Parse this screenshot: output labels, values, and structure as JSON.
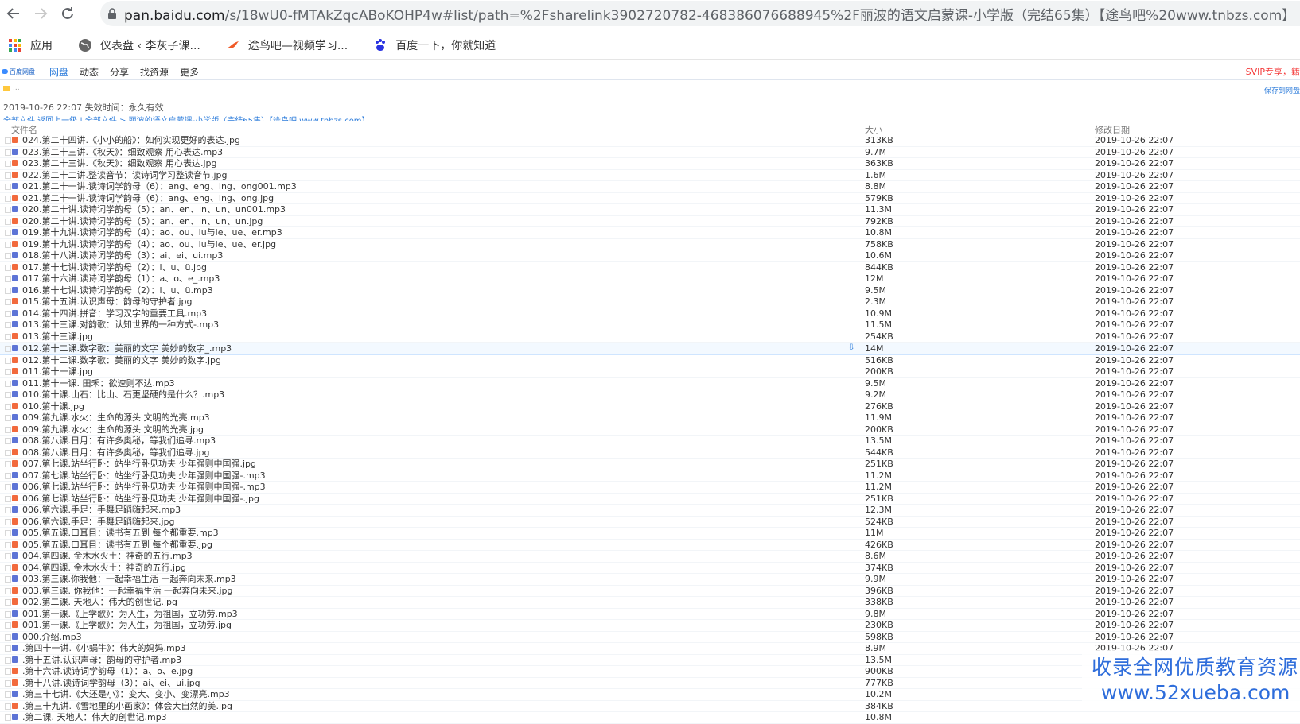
{
  "browser": {
    "url_domain": "pan.baidu.com",
    "url_path": "/s/18wU0-fMTAkZqcABoKOHP4w#list/path=%2Fsharelink3902720782-468386076688945%2F丽波的语文启蒙课-小学版（完结65集）【途鸟吧%20www.tnbzs.com】",
    "back_icon": "arrow-left-icon",
    "forward_icon": "arrow-right-icon",
    "reload_icon": "reload-icon"
  },
  "bookmarks": [
    {
      "label": "应用",
      "icon": "apps-grid-icon"
    },
    {
      "label": "仪表盘 ‹ 李灰子课...",
      "icon": "globe-icon"
    },
    {
      "label": "途鸟吧—视频学习...",
      "icon": "bird-icon"
    },
    {
      "label": "百度一下，你就知道",
      "icon": "paw-icon"
    }
  ],
  "pan": {
    "logo_text": "百度网盘",
    "nav": [
      "网盘",
      "动态",
      "分享",
      "找资源",
      "更多"
    ],
    "svip": "SVIP专享，籍",
    "folder_label": "...",
    "save_label": "保存到网盘",
    "share_time": "2019-10-26 22:07",
    "expire_label": "失效时间：永久有效",
    "breadcrumb": "全部文件  返回上一级 | 全部文件 > 丽波的语文启蒙课-小学版（完结65集）【途鸟吧 www.tnbzs.com】",
    "col_name": "文件名",
    "col_size": "大小",
    "col_date": "修改日期"
  },
  "files": [
    {
      "name": "024.第二十四讲.《小小的船》：如何实现更好的表达.jpg",
      "type": "jpg",
      "size": "313KB",
      "date": "2019-10-26 22:07"
    },
    {
      "name": "023.第二十三讲.《秋天》：细致观察 用心表达.mp3",
      "type": "mp3",
      "size": "9.7M",
      "date": "2019-10-26 22:07"
    },
    {
      "name": "023.第二十三讲.《秋天》：细致观察 用心表达.jpg",
      "type": "jpg",
      "size": "363KB",
      "date": "2019-10-26 22:07"
    },
    {
      "name": "022.第二十二讲.整读音节：读诗词学习整读音节.jpg",
      "type": "jpg",
      "size": "1.6M",
      "date": "2019-10-26 22:07"
    },
    {
      "name": "021.第二十一讲.读诗词学韵母（6）：ang、eng、ing、ong001.mp3",
      "type": "mp3",
      "size": "8.8M",
      "date": "2019-10-26 22:07"
    },
    {
      "name": "021.第二十一讲.读诗词学韵母（6）：ang、eng、ing、ong.jpg",
      "type": "jpg",
      "size": "579KB",
      "date": "2019-10-26 22:07"
    },
    {
      "name": "020.第二十讲.读诗词学韵母（5）：an、en、in、un、un001.mp3",
      "type": "mp3",
      "size": "11.3M",
      "date": "2019-10-26 22:07"
    },
    {
      "name": "020.第二十讲.读诗词学韵母（5）：an、en、in、un、un.jpg",
      "type": "jpg",
      "size": "792KB",
      "date": "2019-10-26 22:07"
    },
    {
      "name": "019.第十九讲.读诗词学韵母（4）：ao、ou、iu与ie、ue、er.mp3",
      "type": "mp3",
      "size": "10.8M",
      "date": "2019-10-26 22:07"
    },
    {
      "name": "019.第十九讲.读诗词学韵母（4）：ao、ou、iu与ie、ue、er.jpg",
      "type": "jpg",
      "size": "758KB",
      "date": "2019-10-26 22:07"
    },
    {
      "name": "018.第十八讲.读诗词学韵母（3）：ai、ei、ui.mp3",
      "type": "mp3",
      "size": "10.6M",
      "date": "2019-10-26 22:07"
    },
    {
      "name": "017.第十七讲.读诗词学韵母（2）：i、u、ü.jpg",
      "type": "jpg",
      "size": "844KB",
      "date": "2019-10-26 22:07"
    },
    {
      "name": "017.第十六讲.读诗词学韵母（1）：a、o、e_.mp3",
      "type": "mp3",
      "size": "12M",
      "date": "2019-10-26 22:07"
    },
    {
      "name": "016.第十七讲.读诗词学韵母（2）：i、u、ü.mp3",
      "type": "mp3",
      "size": "9.5M",
      "date": "2019-10-26 22:07"
    },
    {
      "name": "015.第十五讲.认识声母：韵母的守护者.jpg",
      "type": "jpg",
      "size": "2.3M",
      "date": "2019-10-26 22:07"
    },
    {
      "name": "014.第十四讲.拼音：学习汉字的重要工具.mp3",
      "type": "mp3",
      "size": "10.9M",
      "date": "2019-10-26 22:07"
    },
    {
      "name": "013.第十三课.对韵歌：认知世界的一种方式-.mp3",
      "type": "mp3",
      "size": "11.5M",
      "date": "2019-10-26 22:07"
    },
    {
      "name": "013.第十三课.jpg",
      "type": "jpg",
      "size": "254KB",
      "date": "2019-10-26 22:07"
    },
    {
      "name": "012.第十二课.数字歌：美丽的文字 美妙的数字_.mp3",
      "type": "mp3",
      "size": "14M",
      "date": "2019-10-26 22:07",
      "highlight": true
    },
    {
      "name": "012.第十二课.数字歌：美丽的文字 美妙的数字.jpg",
      "type": "jpg",
      "size": "516KB",
      "date": "2019-10-26 22:07"
    },
    {
      "name": "011.第十一课.jpg",
      "type": "jpg",
      "size": "200KB",
      "date": "2019-10-26 22:07"
    },
    {
      "name": "011.第十一课. 田禾：欲速则不达.mp3",
      "type": "mp3",
      "size": "9.5M",
      "date": "2019-10-26 22:07"
    },
    {
      "name": "010.第十课.山石：比山、石更坚硬的是什么？.mp3",
      "type": "mp3",
      "size": "9.2M",
      "date": "2019-10-26 22:07"
    },
    {
      "name": "010.第十课.jpg",
      "type": "jpg",
      "size": "276KB",
      "date": "2019-10-26 22:07"
    },
    {
      "name": "009.第九课.水火：生命的源头 文明的光亮.mp3",
      "type": "mp3",
      "size": "11.9M",
      "date": "2019-10-26 22:07"
    },
    {
      "name": "009.第九课.水火：生命的源头 文明的光亮.jpg",
      "type": "jpg",
      "size": "200KB",
      "date": "2019-10-26 22:07"
    },
    {
      "name": "008.第八课.日月：有许多奥秘，等我们追寻.mp3",
      "type": "mp3",
      "size": "13.5M",
      "date": "2019-10-26 22:07"
    },
    {
      "name": "008.第八课.日月：有许多奥秘，等我们追寻.jpg",
      "type": "jpg",
      "size": "544KB",
      "date": "2019-10-26 22:07"
    },
    {
      "name": "007.第七课.站坐行卧：站坐行卧见功夫 少年强则中国强.jpg",
      "type": "jpg",
      "size": "251KB",
      "date": "2019-10-26 22:07"
    },
    {
      "name": "007.第七课.站坐行卧：站坐行卧见功夫 少年强则中国强-.mp3",
      "type": "mp3",
      "size": "11.2M",
      "date": "2019-10-26 22:07"
    },
    {
      "name": "006.第七课.站坐行卧：站坐行卧见功夫 少年强则中国强-.mp3",
      "type": "mp3",
      "size": "11.2M",
      "date": "2019-10-26 22:07"
    },
    {
      "name": "006.第七课.站坐行卧：站坐行卧见功夫 少年强则中国强-.jpg",
      "type": "jpg",
      "size": "251KB",
      "date": "2019-10-26 22:07"
    },
    {
      "name": "006.第六课.手足：手舞足蹈嗨起来.mp3",
      "type": "mp3",
      "size": "12.3M",
      "date": "2019-10-26 22:07"
    },
    {
      "name": "006.第六课.手足：手舞足蹈嗨起来.jpg",
      "type": "jpg",
      "size": "524KB",
      "date": "2019-10-26 22:07"
    },
    {
      "name": "005.第五课.口耳目：读书有五到 每个都重要.mp3",
      "type": "mp3",
      "size": "11M",
      "date": "2019-10-26 22:07"
    },
    {
      "name": "005.第五课.口耳目：读书有五到 每个都重要.jpg",
      "type": "jpg",
      "size": "426KB",
      "date": "2019-10-26 22:07"
    },
    {
      "name": "004.第四课. 金木水火土：神奇的五行.mp3",
      "type": "mp3",
      "size": "8.6M",
      "date": "2019-10-26 22:07"
    },
    {
      "name": "004.第四课. 金木水火土：神奇的五行.jpg",
      "type": "jpg",
      "size": "374KB",
      "date": "2019-10-26 22:07"
    },
    {
      "name": "003.第三课.你我他：一起幸福生活 一起奔向未来.mp3",
      "type": "mp3",
      "size": "9.9M",
      "date": "2019-10-26 22:07"
    },
    {
      "name": "003.第三课. 你我他：一起幸福生活 一起奔向未来.jpg",
      "type": "jpg",
      "size": "396KB",
      "date": "2019-10-26 22:07"
    },
    {
      "name": "002.第二课. 天地人：伟大的创世记.jpg",
      "type": "jpg",
      "size": "338KB",
      "date": "2019-10-26 22:07"
    },
    {
      "name": "001.第一课.《上学歌》：为人生，为祖国，立功劳.mp3",
      "type": "mp3",
      "size": "9.8M",
      "date": "2019-10-26 22:07"
    },
    {
      "name": "001.第一课.《上学歌》：为人生，为祖国，立功劳.jpg",
      "type": "jpg",
      "size": "230KB",
      "date": "2019-10-26 22:07"
    },
    {
      "name": "000.介绍.mp3",
      "type": "mp3",
      "size": "598KB",
      "date": "2019-10-26 22:07"
    },
    {
      "name": ".第四十一讲.《小蜗牛》：伟大的妈妈.mp3",
      "type": "mp3",
      "size": "8.9M",
      "date": "2019-10-26 22:07"
    },
    {
      "name": ".第十五讲.认识声母：韵母的守护者.mp3",
      "type": "mp3",
      "size": "13.5M",
      "date": ""
    },
    {
      "name": ".第十六讲.读诗词学韵母（1）：a、o、e.jpg",
      "type": "jpg",
      "size": "900KB",
      "date": ""
    },
    {
      "name": ".第十八讲.读诗词学韵母（3）：ai、ei、ui.jpg",
      "type": "jpg",
      "size": "777KB",
      "date": ""
    },
    {
      "name": ".第三十七讲.《大还是小》：变大、变小、变漂亮.mp3",
      "type": "mp3",
      "size": "10.2M",
      "date": ""
    },
    {
      "name": ".第三十九讲.《雪地里的小画家》：体会大自然的美.jpg",
      "type": "jpg",
      "size": "384KB",
      "date": ""
    },
    {
      "name": ".第二课. 天地人：伟大的创世记.mp3",
      "type": "mp3",
      "size": "10.8M",
      "date": ""
    }
  ],
  "watermark": {
    "line1": "收录全网优质教育资源",
    "line2": "www.52xueba.com"
  },
  "colors": {
    "accent": "#2e7ddb",
    "mp3_icon": "#5d74d6",
    "jpg_icon": "#f26a3d",
    "svip": "#f43b3b"
  }
}
